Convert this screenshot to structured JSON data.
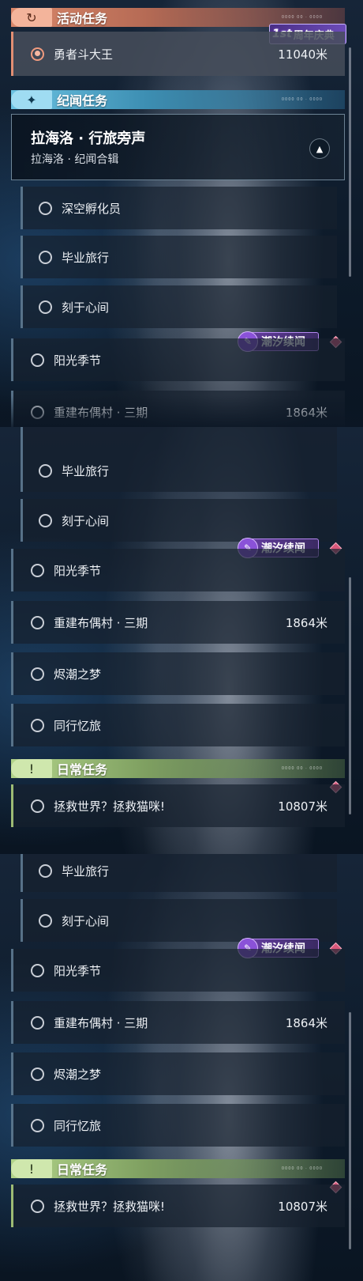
{
  "sections": {
    "activity": "活动任务",
    "story": "纪闻任务",
    "daily": "日常任务"
  },
  "header_deco": "0000 00 · 0000",
  "anniversary_badge": {
    "logo": "1st",
    "label": "周年庆典"
  },
  "chaoxi_badge": "潮汐续闻",
  "story_card": {
    "title": "拉海洛 · 行旅旁声",
    "subtitle": "拉海洛 · 纪闻合辑"
  },
  "quests": {
    "yongzhe": {
      "name": "勇者斗大王",
      "distance": "11040米"
    },
    "shenkong": {
      "name": "深空孵化员"
    },
    "biye": {
      "name": "毕业旅行"
    },
    "keyu": {
      "name": "刻于心间"
    },
    "yangguang": {
      "name": "阳光季节"
    },
    "chongjian": {
      "name": "重建布偶村 · 三期",
      "distance": "1864米"
    },
    "jinchao": {
      "name": "烬潮之梦"
    },
    "tongxing": {
      "name": "同行忆旅"
    },
    "zhengjiu": {
      "name": "拯救世界？拯救猫咪!",
      "distance": "10807米"
    }
  },
  "icons": {
    "activity_badge": "return-arrow-icon",
    "story_badge": "sparkle-icon",
    "daily_badge": "exclamation-icon",
    "card_button": "expand-icon",
    "chaoxi": "feather-icon",
    "gem": "diamond-icon",
    "quest_ring": "radio-ring-icon"
  },
  "colors": {
    "activity_accent": "#e28f73",
    "story_accent": "#6cc3e2",
    "daily_accent": "#b2d48a",
    "chaoxi": "#8a52d8",
    "gem": "#d9587b"
  }
}
